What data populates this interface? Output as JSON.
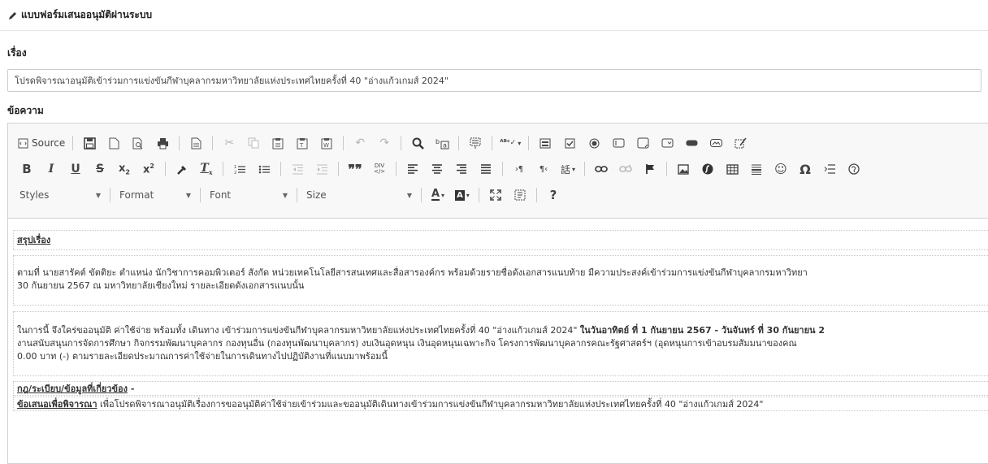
{
  "header": {
    "title": "แบบฟอร์มเสนออนุมัติผ่านระบบ"
  },
  "subject": {
    "label": "เรื่อง",
    "value": "โปรดพิจารณาอนุมัติเข้าร่วมการแข่งขันกีฬาบุคลากรมหาวิทยาลัยแห่งประเทศไทยครั้งที่ 40 \"อ่างแก้วเกมส์ 2024\""
  },
  "message": {
    "label": "ข้อความ"
  },
  "toolbar": {
    "source_label": "Source",
    "styles_label": "Styles",
    "format_label": "Format",
    "font_label": "Font",
    "size_label": "Size",
    "bold": "B",
    "italic": "I",
    "underline": "U",
    "strike": "S",
    "help": "?"
  },
  "content": {
    "summary_heading": "สรุปเรื่อง",
    "p1_line1": "ตามที่ นายสารัคต์ ขัตติยะ ตำแหน่ง นักวิชาการคอมพิวเตอร์ สังกัด หน่วยเทคโนโลยีสารสนเทศและสื่อสารองค์กร พร้อมด้วยรายชื่อดังเอกสารแนบท้าย มีความประสงค์เข้าร่วมการแข่งขันกีฬาบุคลากรมหาวิทยา",
    "p1_line2": "30 กันยายน 2567 ณ มหาวิทยาลัยเชียงใหม่ รายละเอียดดังเอกสารแนบนั้น",
    "p2_line1_a": "ในการนี้ จึงใคร่ขออนุมัติ ค่าใช้จ่าย พร้อมทั้ง เดินทาง เข้าร่วมการแข่งขันกีฬาบุคลากรมหาวิทยาลัยแห่งประเทศไทยครั้งที่ 40 \"อ่างแก้วเกมส์ 2024\" ",
    "p2_line1_b": "ในวันอาทิตย์ ที่ 1 กันยายน 2567 - วันจันทร์ ที่ 30 กันยายน 2",
    "p2_line2": "งานสนับสนุนการจัดการศึกษา กิจกรรมพัฒนาบุคลากร กองทุนอื่น (กองทุนพัฒนาบุคลากร) งบเงินอุดหนุน เงินอุดหนุนเฉพาะกิจ โครงการพัฒนาบุคลากรคณะรัฐศาสตร์ฯ (อุดหนุนการเข้าอบรมสัมมนาของคณ",
    "p2_line3": "0.00 บาท (-) ตามรายละเอียดประมาณการค่าใช้จ่ายในการเดินทางไปปฏิบัติงานที่แนบมาพร้อมนี้",
    "rules_heading": "กฎ/ระเบียบ/ข้อมูลที่เกี่ยวข้อง",
    "rules_value": " -",
    "proposal_heading": "ข้อเสนอเพื่อพิจารณา",
    "proposal_text": " เพื่อโปรดพิจารณาอนุมัติเรื่องการขออนุมัติค่าใช้จ่ายเข้าร่วมและขออนุมัติเดินทางเข้าร่วมการแข่งขันกีฬาบุคลากรมหาวิทยาลัยแห่งประเทศไทยครั้งที่ 40 \"อ่างแก้วเกมส์ 2024\""
  },
  "icons": [
    "pencil-icon",
    "source-icon",
    "save-icon",
    "new-page-icon",
    "preview-icon",
    "print-icon",
    "templates-icon",
    "cut-icon",
    "copy-icon",
    "paste-icon",
    "paste-text-icon",
    "paste-word-icon",
    "undo-icon",
    "redo-icon",
    "find-icon",
    "replace-icon",
    "select-all-icon",
    "spellcheck-icon",
    "form-icon",
    "checkbox-icon",
    "radio-icon",
    "textfield-icon",
    "textarea-icon",
    "select-icon",
    "button-icon",
    "image-button-icon",
    "hidden-field-icon",
    "subscript-icon",
    "superscript-icon",
    "copy-format-icon",
    "remove-format-icon",
    "numbered-list-icon",
    "bulleted-list-icon",
    "outdent-icon",
    "indent-icon",
    "blockquote-icon",
    "div-icon",
    "align-left-icon",
    "align-center-icon",
    "align-right-icon",
    "justify-icon",
    "ltr-icon",
    "rtl-icon",
    "language-icon",
    "link-icon",
    "unlink-icon",
    "anchor-icon",
    "image-icon",
    "flash-icon",
    "table-icon",
    "horizontal-rule-icon",
    "smiley-icon",
    "special-char-icon",
    "page-break-icon",
    "iframe-icon",
    "text-color-icon",
    "bg-color-icon",
    "maximize-icon",
    "show-blocks-icon",
    "help-icon"
  ]
}
